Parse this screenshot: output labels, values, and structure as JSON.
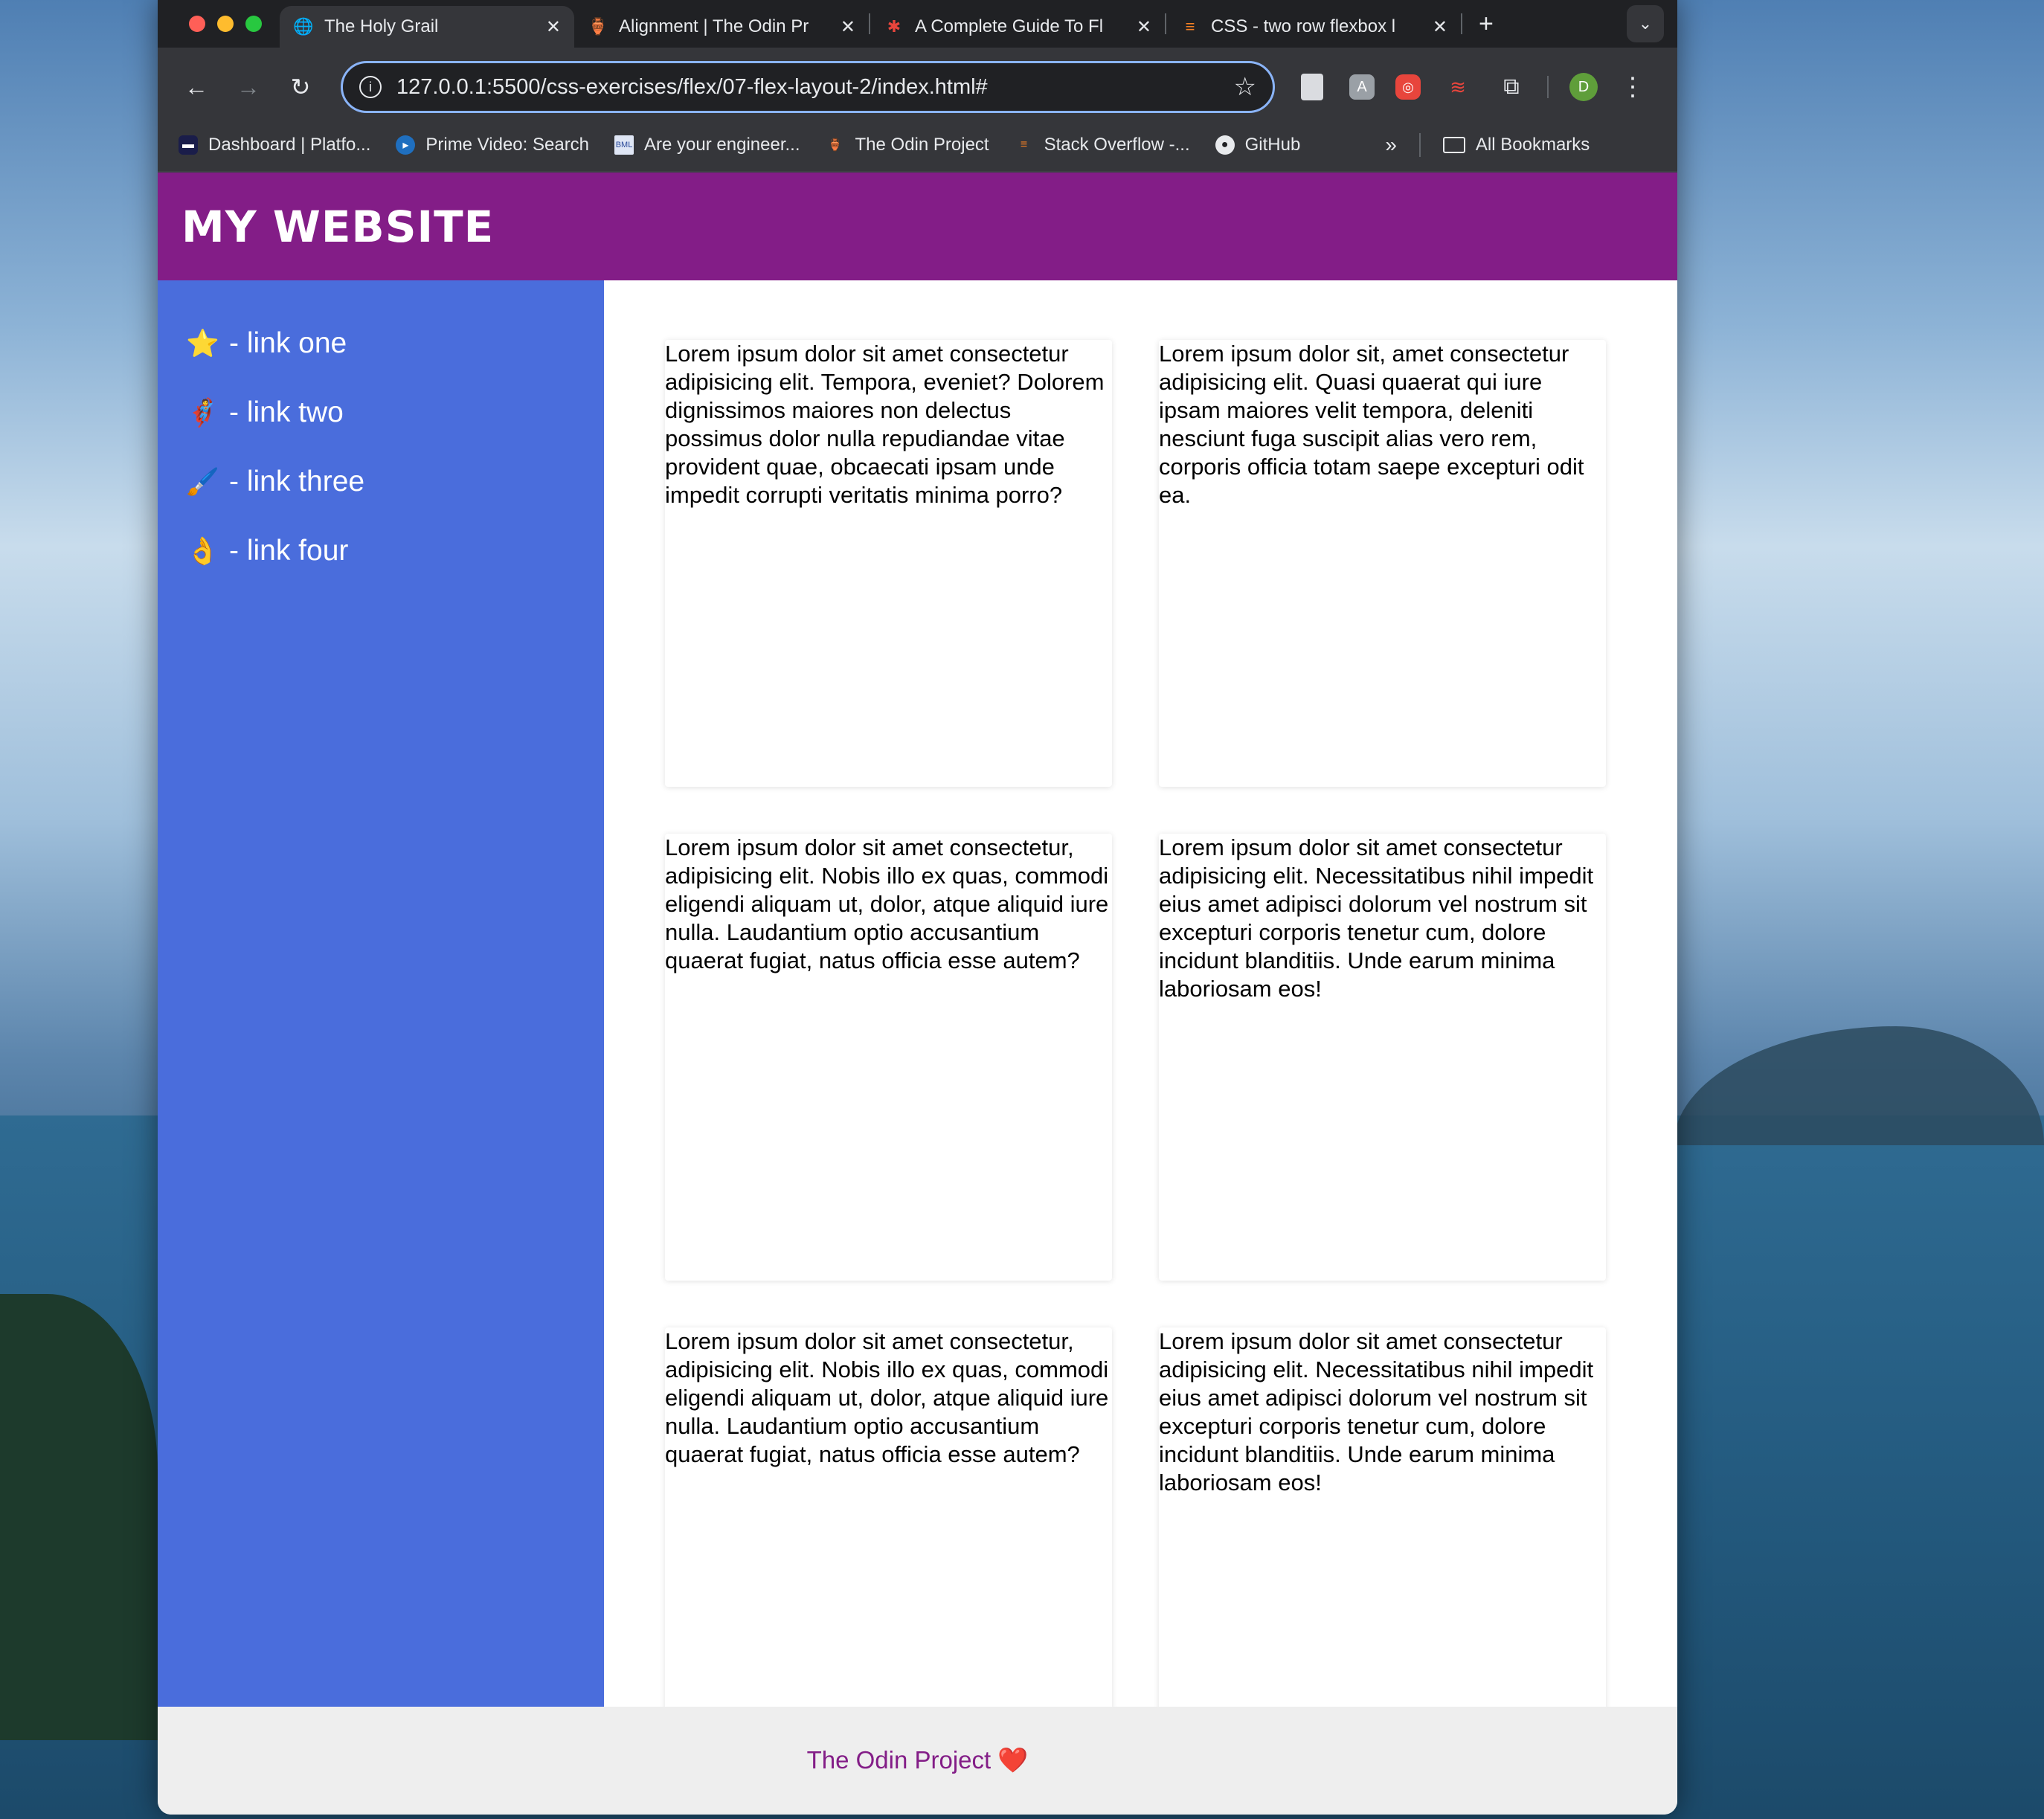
{
  "browser": {
    "tabs": [
      {
        "title": "The Holy Grail",
        "icon": "globe-icon",
        "active": true
      },
      {
        "title": "Alignment | The Odin Pr",
        "icon": "odin-icon",
        "active": false
      },
      {
        "title": "A Complete Guide To Fl",
        "icon": "css-tricks-icon",
        "active": false
      },
      {
        "title": "CSS - two row flexbox l",
        "icon": "stackoverflow-icon",
        "active": false
      }
    ],
    "url": "127.0.0.1:5500/css-exercises/flex/07-flex-layout-2/index.html#",
    "profile_initial": "D",
    "bookmarks": [
      {
        "label": "Dashboard | Platfo...",
        "icon": "dashboard-icon"
      },
      {
        "label": "Prime Video: Search",
        "icon": "prime-video-icon"
      },
      {
        "label": "Are your engineer...",
        "icon": "bml-icon"
      },
      {
        "label": "The Odin Project",
        "icon": "odin-icon"
      },
      {
        "label": "Stack Overflow -...",
        "icon": "stackoverflow-icon"
      },
      {
        "label": "GitHub",
        "icon": "github-icon"
      }
    ],
    "all_bookmarks": "All Bookmarks"
  },
  "site": {
    "title": "MY WEBSITE",
    "links": [
      {
        "emoji": "⭐",
        "label": "- link one"
      },
      {
        "emoji": "🦸",
        "label": "- link two"
      },
      {
        "emoji": "🖌️",
        "label": "- link three"
      },
      {
        "emoji": "👌",
        "label": "- link four"
      }
    ],
    "cards": [
      "Lorem ipsum dolor sit amet consectetur adipisicing elit. Tempora, eveniet? Dolorem dignissimos maiores non delectus possimus dolor nulla repudiandae vitae provident quae, obcaecati ipsam unde impedit corrupti veritatis minima porro?",
      "Lorem ipsum dolor sit, amet consectetur adipisicing elit. Quasi quaerat qui iure ipsam maiores velit tempora, deleniti nesciunt fuga suscipit alias vero rem, corporis officia totam saepe excepturi odit ea.",
      "Lorem ipsum dolor sit amet consectetur, adipisicing elit. Nobis illo ex quas, commodi eligendi aliquam ut, dolor, atque aliquid iure nulla. Laudantium optio accusantium quaerat fugiat, natus officia esse autem?",
      "Lorem ipsum dolor sit amet consectetur adipisicing elit. Necessitatibus nihil impedit eius amet adipisci dolorum vel nostrum sit excepturi corporis tenetur cum, dolore incidunt blanditiis. Unde earum minima laboriosam eos!",
      "Lorem ipsum dolor sit amet consectetur, adipisicing elit. Nobis illo ex quas, commodi eligendi aliquam ut, dolor, atque aliquid iure nulla. Laudantium optio accusantium quaerat fugiat, natus officia esse autem?",
      "Lorem ipsum dolor sit amet consectetur adipisicing elit. Necessitatibus nihil impedit eius amet adipisci dolorum vel nostrum sit excepturi corporis tenetur cum, dolore incidunt blanditiis. Unde earum minima laboriosam eos!"
    ],
    "footer": "The Odin Project ❤️"
  },
  "colors": {
    "header": "#831d87",
    "sidebar": "#4a6ddc",
    "footer_bg": "#eeeeee"
  }
}
